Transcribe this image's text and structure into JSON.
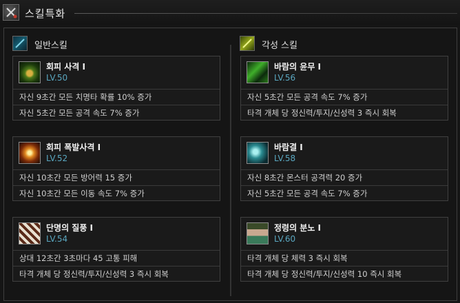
{
  "window": {
    "title": "스킬특화",
    "title_icon": "crossed-swords-icon"
  },
  "sections": {
    "normal": {
      "label": "일반스킬",
      "icon": "normal-skill-icon"
    },
    "awakening": {
      "label": "각성 스킬",
      "icon": "awakening-skill-icon"
    }
  },
  "normal_skills": [
    {
      "name": "회피 사격 I",
      "level": "LV.50",
      "icon": "swirl-shot-icon",
      "effects": [
        "자신 9초간 모든 치명타 확률 10% 증가",
        "자신 5초간 모든 공격 속도 7% 증가"
      ]
    },
    {
      "name": "회피 폭발사격 I",
      "level": "LV.52",
      "icon": "explosive-shot-icon",
      "effects": [
        "자신 10초간 모든 방어력 15 증가",
        "자신 10초간 모든 이동 속도 7% 증가"
      ]
    },
    {
      "name": "단명의 질풍 I",
      "level": "LV.54",
      "icon": "gale-icon",
      "effects": [
        "상대 12초간 3초마다 45 고통 피해",
        "타격 개체 당 정신력/투지/신성력 3 즉시 회복"
      ]
    }
  ],
  "awakening_skills": [
    {
      "name": "바람의 윤무 I",
      "level": "LV.56",
      "icon": "wind-dance-icon",
      "effects": [
        "자신 5초간 모든 공격 속도 7% 증가",
        "타격 개체 당 정신력/투지/신성력 3 즉시 회복"
      ]
    },
    {
      "name": "바람결 I",
      "level": "LV.58",
      "icon": "wind-wave-icon",
      "effects": [
        "자신 8초간 몬스터 공격력 20 증가",
        "자신 5초간 모든 공격 속도 7% 증가"
      ]
    },
    {
      "name": "정령의 분노 I",
      "level": "LV.60",
      "icon": "spirit-wrath-icon",
      "effects": [
        "타격 개체 당 체력 3 즉시 회복",
        "타격 개체 당 정신력/투지/신성력 10 즉시 회복"
      ]
    }
  ]
}
